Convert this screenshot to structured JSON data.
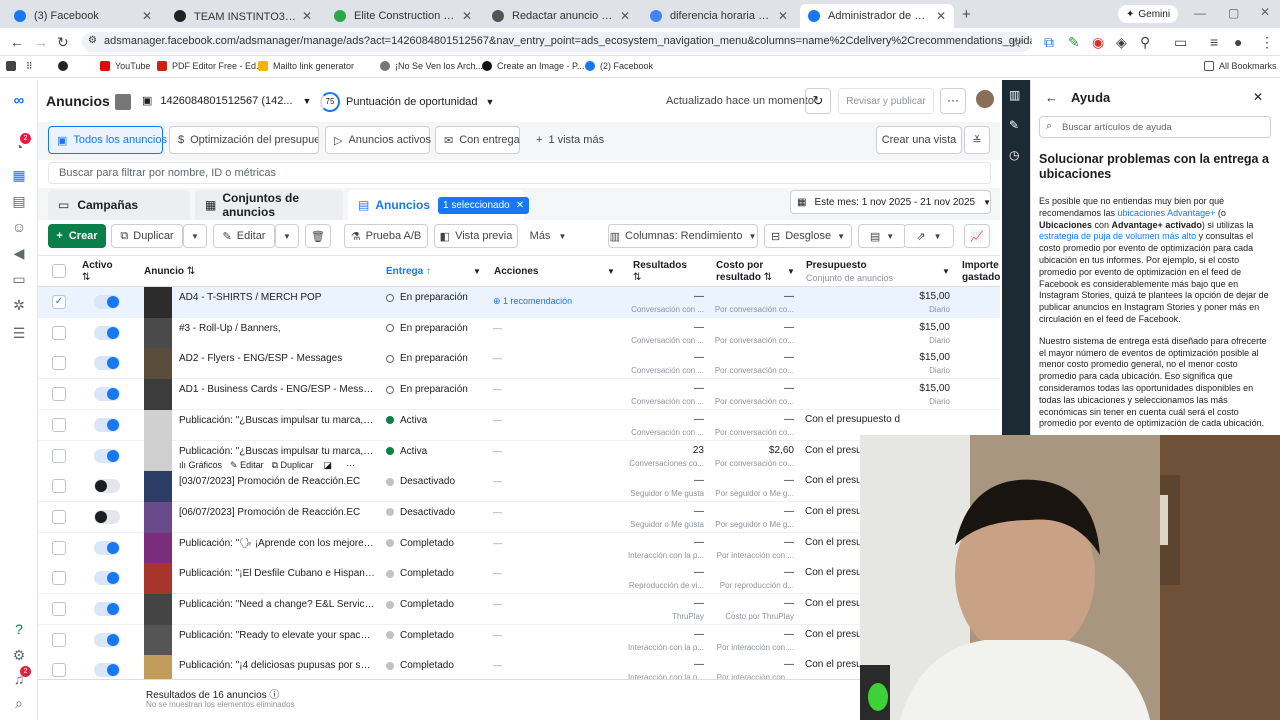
{
  "browser": {
    "tabs": [
      {
        "title": "(3) Facebook",
        "color": "#1877f2"
      },
      {
        "title": "TEAM INSTINTO360 🔥 | Trello",
        "color": "#222222"
      },
      {
        "title": "Elite Construction & Cleaning |",
        "color": "#2aa84a"
      },
      {
        "title": "Redactar anuncio tarjetas",
        "color": "#555555"
      },
      {
        "title": "diferencia horaria Ca y nJ - Bus",
        "color": "#4285f4"
      },
      {
        "title": "Administrador de anuncios - Ad",
        "color": "#1877f2"
      }
    ],
    "gemini_label": "Gemini",
    "url": "adsmanager.facebook.com/adsmanager/manage/ads?act=1426084801512567&nav_entry_point=ads_ecosystem_navigation_menu&columns=name%2Cdelivery%2Crecommendations_guidance%2Cresults%2Ccost_pe...",
    "bookmarks": [
      "YouTube",
      "PDF Editor Free - Ed...",
      "Mailto link generator",
      "¡No Se Ven los Arch...",
      "Create an Image - P...",
      "(2) Facebook"
    ],
    "all_bookmarks": "All Bookmarks"
  },
  "header": {
    "title": "Anuncios",
    "account": "1426084801512567 (142...",
    "score": "75",
    "score_label": "Puntuación de oportunidad",
    "updated": "Actualizado hace un momento",
    "review_publish": "Revisar y publicar",
    "notifications_badge": "2"
  },
  "filters": {
    "items": [
      "Todos los anuncios",
      "Optimización del presupuesto",
      "Anuncios activos",
      "Con entrega",
      "1 vista más"
    ],
    "create_view": "Crear una vista",
    "search_placeholder": "Buscar para filtrar por nombre, ID o métricas"
  },
  "levels": {
    "campaigns": "Campañas",
    "adsets": "Conjuntos de anuncios",
    "ads": "Anuncios",
    "selected": "1 seleccionado",
    "date_range": "Este mes: 1 nov 2025 - 21 nov 2025"
  },
  "toolbar": {
    "create": "Crear",
    "duplicate": "Duplicar",
    "edit": "Editar",
    "ab_test": "Prueba A/B",
    "preview": "Vista previa",
    "more": "Más",
    "columns": "Columnas: Rendimiento",
    "breakdown": "Desglose"
  },
  "table": {
    "headers": {
      "active": "Activo",
      "ad": "Anuncio",
      "delivery": "Entrega",
      "actions": "Acciones",
      "results": "Resultados",
      "cost": "Costo por",
      "cost2": "resultado",
      "budget": "Presupuesto",
      "budget_sub": "Conjunto de anuncios",
      "amount": "Importe",
      "amount2": "gastado"
    },
    "rows": [
      {
        "name": "AD4 - T-SHIRTS / MERCH POP",
        "status": "En preparación",
        "dot": "ring",
        "action": "1 recomendación",
        "res": "—",
        "res_sub": "Conversación con ...",
        "cost": "—",
        "cost_sub": "Por conversación co...",
        "budget": "$15,00",
        "budget_sub": "Diario",
        "on": true,
        "checked": true
      },
      {
        "name": "#3 - Roll-Up / Banners,",
        "status": "En preparación",
        "dot": "ring",
        "action": "—",
        "res": "—",
        "res_sub": "Conversación con ...",
        "cost": "—",
        "cost_sub": "Por conversación co...",
        "budget": "$15,00",
        "budget_sub": "Diario",
        "on": true
      },
      {
        "name": "AD2 - Flyers - ENG/ESP - Messages",
        "status": "En preparación",
        "dot": "ring",
        "action": "—",
        "res": "—",
        "res_sub": "Conversación con ...",
        "cost": "—",
        "cost_sub": "Por conversación co...",
        "budget": "$15,00",
        "budget_sub": "Diario",
        "on": true
      },
      {
        "name": "AD1 - Business Cards - ENG/ESP - Messag...",
        "status": "En preparación",
        "dot": "ring",
        "action": "—",
        "res": "—",
        "res_sub": "Conversación con ...",
        "cost": "—",
        "cost_sub": "Por conversación co...",
        "budget": "$15,00",
        "budget_sub": "Diario",
        "on": true
      },
      {
        "name": "Publicación: \"¿Buscas impulsar tu marca, atr...",
        "status": "Activa",
        "dot": "green",
        "action": "—",
        "res": "—",
        "res_sub": "Conversación con ...",
        "cost": "—",
        "cost_sub": "Por conversación co...",
        "budget": "Con el presupuesto de la campaña",
        "on": true
      },
      {
        "name": "Publicación: \"¿Buscas impulsar tu marca, atr...",
        "status": "Activa",
        "dot": "green",
        "action": "—",
        "res": "23",
        "res_sub": "Conversaciones co...",
        "cost": "$2,60",
        "cost_sub": "Por conversación co...",
        "budget": "Con el presupuesto de la campaña",
        "on": true,
        "hover": true
      },
      {
        "name": "[03/07/2023] Promoción de Reacción.EC",
        "status": "Desactivado",
        "dot": "gray",
        "action": "—",
        "res": "—",
        "res_sub": "Seguidor o Me gusta",
        "cost": "—",
        "cost_sub": "Por seguidor o Me g...",
        "budget": "Con el presupuesto de la campaña",
        "on": false
      },
      {
        "name": "[06/07/2023] Promoción de Reacción.EC",
        "status": "Desactivado",
        "dot": "gray",
        "action": "—",
        "res": "—",
        "res_sub": "Seguidor o Me gusta",
        "cost": "—",
        "cost_sub": "Por seguidor o Me g...",
        "budget": "Con el presupuesto de la campaña",
        "on": false
      },
      {
        "name": "Publicación: \"🗣 ¡Aprende con los mejores! ...",
        "status": "Completado",
        "dot": "gray",
        "action": "—",
        "res": "—",
        "res_sub": "Interacción con la p...",
        "cost": "—",
        "cost_sub": "Por interacción con ...",
        "budget": "Con el presupuesto de la campaña",
        "on": true
      },
      {
        "name": "Publicación: \"¡El Desfile Cubano e Hispanoa...",
        "status": "Completado",
        "dot": "gray",
        "action": "—",
        "res": "—",
        "res_sub": "Reproducción de vi...",
        "cost": "—",
        "cost_sub": "Por reproducción d...",
        "budget": "Con el presupuesto de la campaña",
        "on": true
      },
      {
        "name": "Publicación: \"Need a change? E&L Services ...",
        "status": "Completado",
        "dot": "gray",
        "action": "—",
        "res": "—",
        "res_sub": "ThruPlay",
        "cost": "—",
        "cost_sub": "Costo por ThruPlay",
        "budget": "Con el presupuesto de la campaña",
        "on": true
      },
      {
        "name": "Publicación: \"Ready to elevate your space? ...",
        "status": "Completado",
        "dot": "gray",
        "action": "—",
        "res": "—",
        "res_sub": "Interacción con la p...",
        "cost": "—",
        "cost_sub": "Por interacción con ...",
        "budget": "Con el presupuesto de la campaña",
        "on": true
      },
      {
        "name": "Publicación: \"¡4 deliciosas pupusas por sol...",
        "status": "Completado",
        "dot": "gray",
        "action": "—",
        "res": "—",
        "res_sub": "Interacción con la p...",
        "cost": "—",
        "cost_sub": "Por interacción con ...",
        "budget": "Con el presupuesto de la campaña",
        "on": true
      }
    ],
    "row_hover_links": [
      "Gráficos",
      "Editar",
      "Duplicar"
    ],
    "footer_results": "Resultados de 16 anuncios",
    "footer_note": "No se muestran los elementos eliminados"
  },
  "help": {
    "title": "Ayuda",
    "search_placeholder": "Buscar artículos de ayuda",
    "article_title": "Solucionar problemas con la entrega a ubicaciones",
    "p1_a": "Es posible que no entiendas muy bien por qué recomendamos las ",
    "p1_link1": "ubicaciones Advantage+",
    "p1_b": " (o ",
    "p1_bold1": "Ubicaciones",
    "p1_c": " con ",
    "p1_bold2": "Advantage+ activado",
    "p1_d": ") si utilizas la ",
    "p1_link2": "estrategia de puja de volumen más alto",
    "p1_e": " y consultas el costo promedio por evento de optimización para cada ubicación en tus informes. Por ejemplo, si el costo promedio por evento de optimización en el feed de Facebook es considerablemente más bajo que en Instagram Stories, quizá te plantees la opción de dejar de publicar anuncios en Instagram Stories y poner más en circulación en el feed de Facebook.",
    "p2": "Nuestro sistema de entrega está diseñado para ofrecerte el mayor número de eventos de optimización posible al menor costo promedio general, no el menor costo promedio para cada ubicación. Eso significa que consideramos todas las oportunidades disponibles en todas las ubicaciones y seleccionamos las más económicas sin tener en cuenta cuál será el costo promedio por evento de optimización de cada ubicación."
  },
  "colors": {
    "accent": "#1877f2",
    "create": "#0a7f49",
    "active_dot": "#0a7f49"
  }
}
